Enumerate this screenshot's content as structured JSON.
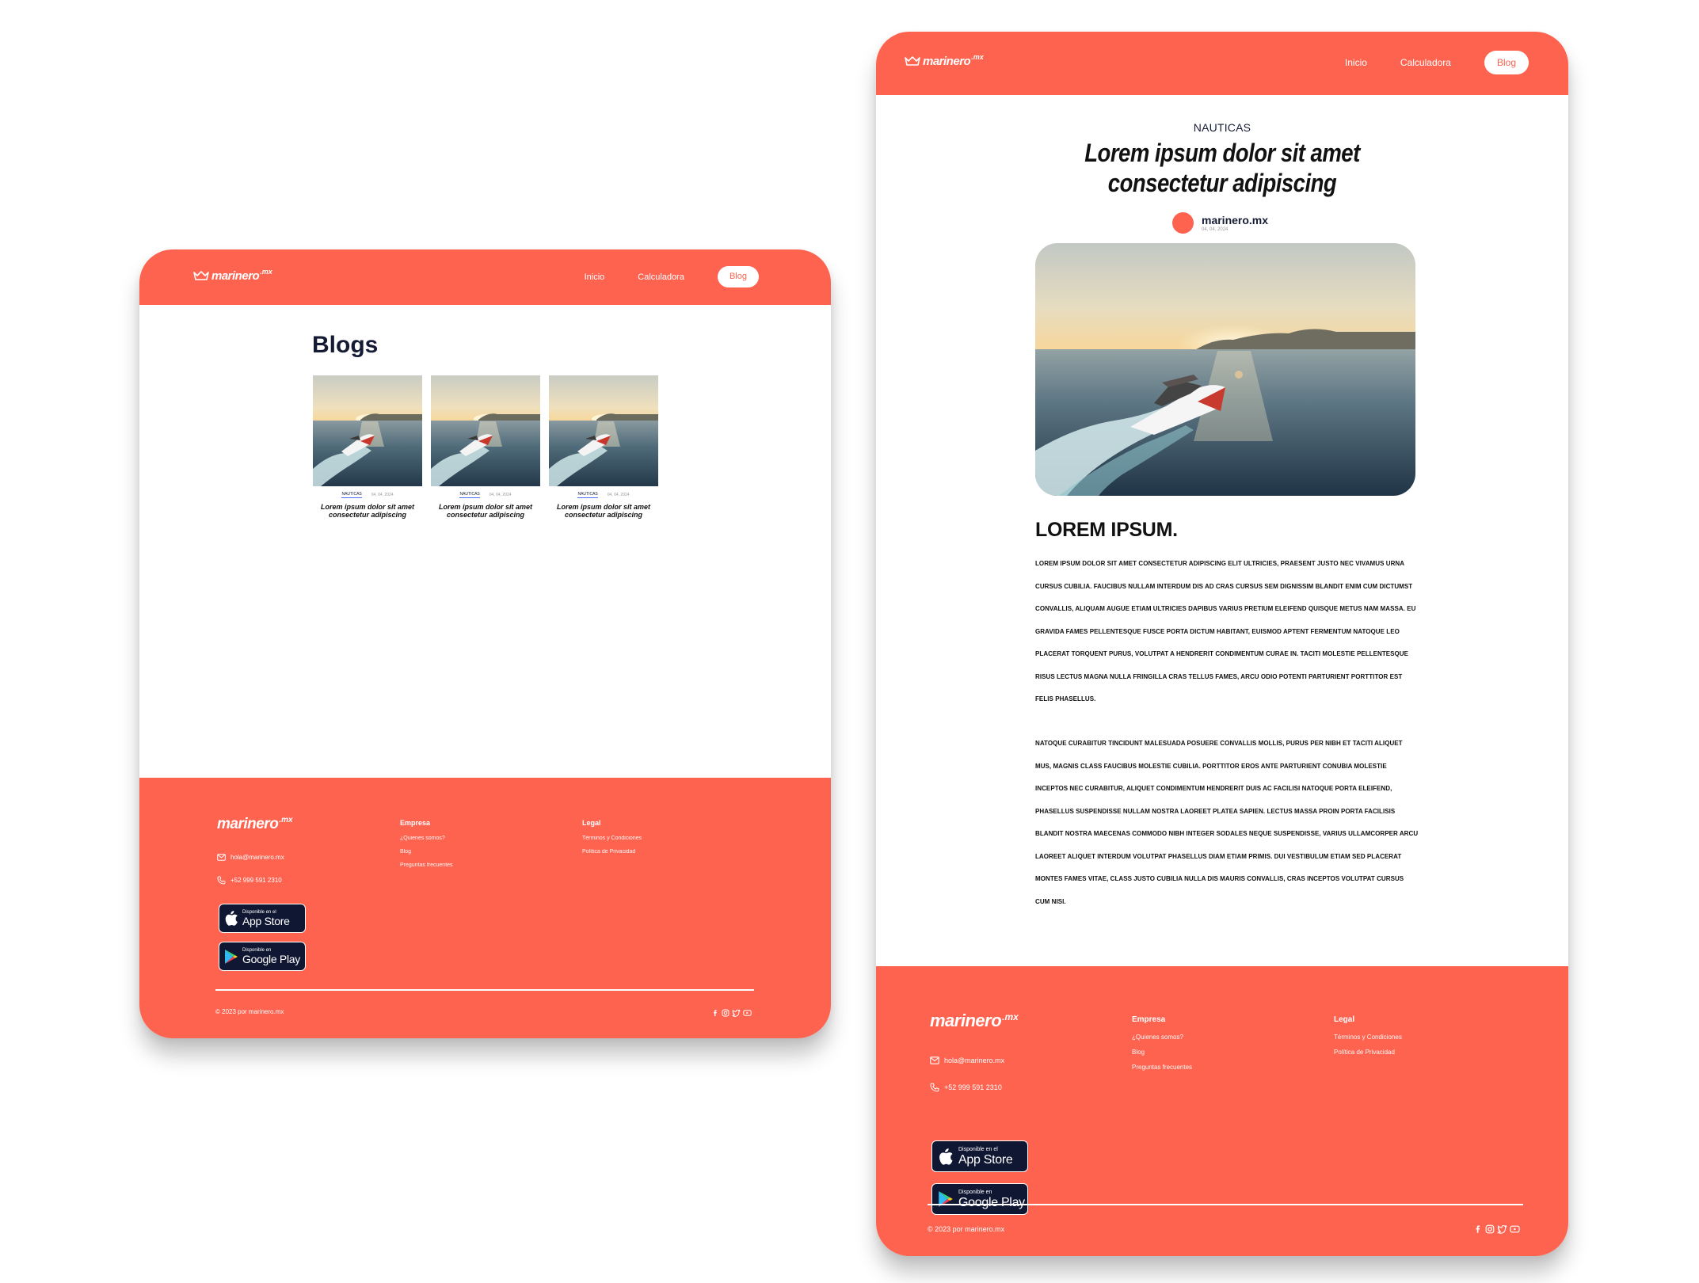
{
  "brand": {
    "name": "marinero",
    "suffix": ".mx",
    "colors": {
      "primary": "#fe6350",
      "navy": "#141b33",
      "white": "#ffffff"
    }
  },
  "nav": {
    "items": [
      {
        "label": "Inicio"
      },
      {
        "label": "Calculadora"
      }
    ],
    "active": {
      "label": "Blog"
    }
  },
  "blog_list": {
    "title": "Blogs",
    "cards": [
      {
        "category": "NAUTICAS",
        "date": "04, 04, 2024",
        "title": "Lorem ipsum dolor sit amet consectetur adipiscing"
      },
      {
        "category": "NAUTICAS",
        "date": "04, 04, 2024",
        "title": "Lorem ipsum dolor sit amet consectetur adipiscing"
      },
      {
        "category": "NAUTICAS",
        "date": "04, 04, 2024",
        "title": "Lorem ipsum dolor sit amet consectetur adipiscing"
      }
    ]
  },
  "article": {
    "category": "NAUTICAS",
    "title_line1": "Lorem ipsum dolor sit amet",
    "title_line2": "consectetur adipiscing",
    "author": {
      "name": "marinero.mx",
      "date": "04, 04, 2024"
    },
    "heading": "LOREM IPSUM.",
    "paragraphs": [
      "Lorem ipsum dolor sit amet consectetur adipiscing elit ultricies, praesent justo nec vivamus urna cursus cubilia. Faucibus nullam interdum dis ad cras cursus sem dignissim blandit enim cum dictumst convallis, aliquam augue etiam ultricies dapibus varius pretium eleifend quisque metus nam massa. Eu gravida fames pellentesque fusce porta dictum habitant, euismod aptent fermentum natoque leo placerat torquent purus, volutpat a hendrerit condimentum curae in. Taciti molestie pellentesque risus lectus magna nulla fringilla cras tellus fames, arcu odio potenti parturient porttitor est felis phasellus.",
      "Natoque curabitur tincidunt malesuada posuere convallis mollis, purus per nibh et taciti aliquet mus, magnis class faucibus molestie cubilia. Porttitor eros ante parturient conubia molestie inceptos nec curabitur, aliquet condimentum hendrerit duis ac facilisi natoque porta eleifend, phasellus suspendisse nullam nostra laoreet platea sapien. Lectus massa proin porta facilisis blandit nostra maecenas commodo nibh integer sodales neque suspendisse, varius ullamcorper arcu laoreet aliquet interdum volutpat phasellus diam etiam primis. Dui vestibulum etiam sed placerat montes fames vitae, class justo cubilia nulla dis mauris convallis, cras inceptos volutpat cursus cum nisi."
    ]
  },
  "footer": {
    "email": "hola@marinero.mx",
    "phone": "+52 999 591 2310",
    "columns": [
      {
        "title": "Empresa",
        "items": [
          "¿Quienes somos?",
          "Blog",
          "Preguntas frecuentes"
        ]
      },
      {
        "title": "Legal",
        "items": [
          "Términos y Condiciones",
          "Política de Privacidad"
        ]
      }
    ],
    "app_store": {
      "small": "Disponible en el",
      "big": "App Store"
    },
    "google_play": {
      "small": "Disponible en",
      "big": "Google Play"
    },
    "copyright": "© 2023 por marinero.mx",
    "social_icons": [
      "facebook-icon",
      "instagram-icon",
      "twitter-icon",
      "youtube-icon"
    ]
  }
}
